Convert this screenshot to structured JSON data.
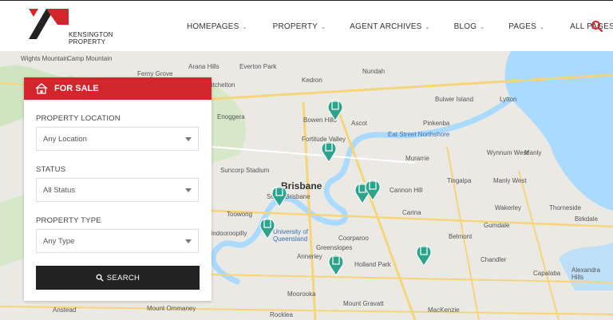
{
  "header": {
    "logo_text_line1": "KENSINGTON",
    "logo_text_line2": "PROPERTY",
    "nav": [
      {
        "label": "HOMEPAGES"
      },
      {
        "label": "PROPERTY"
      },
      {
        "label": "AGENT ARCHIVES"
      },
      {
        "label": "BLOG"
      },
      {
        "label": "PAGES"
      },
      {
        "label": "ALL PAGES"
      }
    ],
    "search_icon": "search-icon"
  },
  "search_panel": {
    "title": "FOR SALE",
    "fields": [
      {
        "label": "PROPERTY LOCATION",
        "value": "Any Location"
      },
      {
        "label": "STATUS",
        "value": "All Status"
      },
      {
        "label": "PROPERTY TYPE",
        "value": "Any Type"
      }
    ],
    "button": "SEARCH"
  },
  "map": {
    "labels": {
      "wights_mountain": "Wights Mountain",
      "camp_mountain": "Camp Mountain",
      "arana_hills": "Arana Hills",
      "everton_park": "Everton Park",
      "nundah": "Nundah",
      "kedron": "Kedron",
      "mitchelton": "Mitchelton",
      "enoggera": "Enoggera",
      "bulwer_island": "Bulwer Island",
      "lytton": "Lytton",
      "ascot": "Ascot",
      "pinkenba": "Pinkenba",
      "bowen_hills": "Bowen Hills",
      "eat_street": "Eat Street Northshore",
      "fortitude_valley": "Fortitude Valley",
      "murarrie": "Murarrie",
      "wynnum_west": "Wynnum West",
      "manly": "Manly",
      "suncorp": "Suncorp Stadium",
      "tingalpa": "Tingalpa",
      "manly_west": "Manly West",
      "brisbane": "Brisbane",
      "cannon_hill": "Cannon Hill",
      "wakerley": "Wakerley",
      "toowong": "Toowong",
      "thorneside": "Thorneside",
      "birkdale": "Birkdale",
      "carina": "Carina",
      "gumdale": "Gumdale",
      "uq": "University of Queensland",
      "coorparoo": "Coorparoo",
      "belmont": "Belmont",
      "indooroopilly": "Indooroopilly",
      "greenslopes": "Greenslopes",
      "chandler": "Chandler",
      "annerley": "Annerley",
      "holland_park": "Holland Park",
      "capalaba": "Capalaba",
      "alexandra_hills": "Alexandra Hills",
      "moorooka": "Moorooka",
      "mount_gravatt": "Mount Gravatt",
      "anstead": "Anstead",
      "mount_ommaney": "Mount Ommaney",
      "rocklea": "Rocklea",
      "mackenzie": "MacKenzie",
      "ferny_grove": "Ferny Grove",
      "south_brisbane": "South Brisbane"
    }
  },
  "colors": {
    "accent": "#d2262c",
    "pin": "#2ea38b",
    "water": "#aadaff"
  }
}
